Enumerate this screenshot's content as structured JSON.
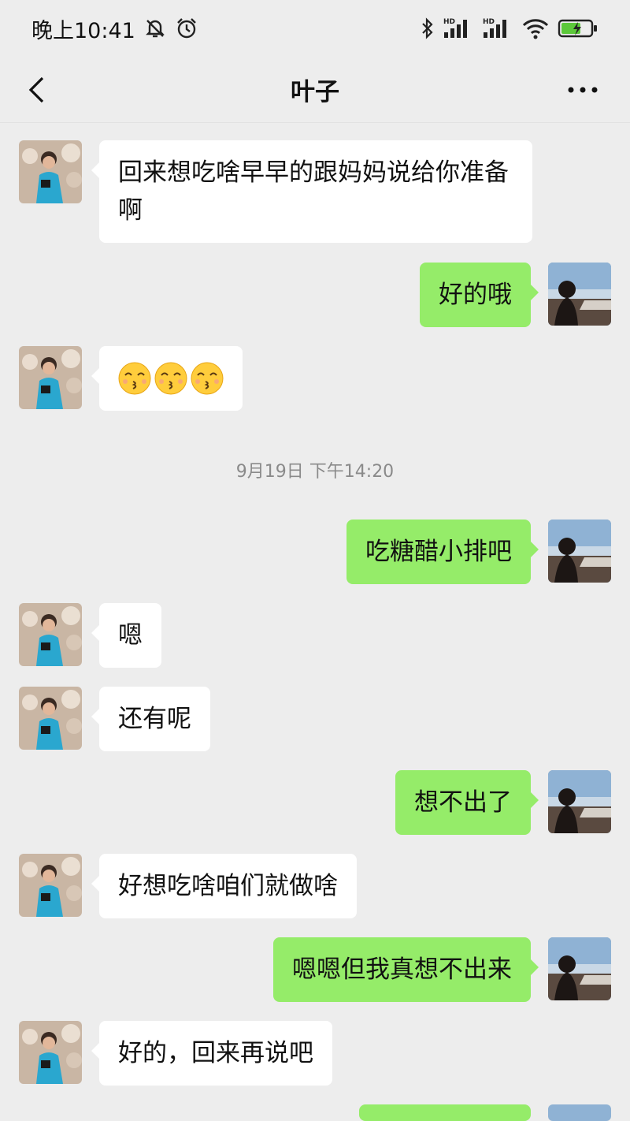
{
  "status_bar": {
    "time": "晚上10:41",
    "signal_1_label": "HD",
    "signal_2_label": "HD"
  },
  "header": {
    "title": "叶子"
  },
  "chat": {
    "messages": [
      {
        "side": "left",
        "text": "回来想吃啥早早的跟妈妈说给你准备啊"
      },
      {
        "side": "right",
        "text": "好的哦"
      },
      {
        "side": "left",
        "emoji": [
          "kissing-face-smiling-eyes",
          "kissing-face-smiling-eyes",
          "kissing-face-smiling-eyes"
        ]
      },
      {
        "side": "right",
        "text": "吃糖醋小排吧"
      },
      {
        "side": "left",
        "text": "嗯"
      },
      {
        "side": "left",
        "text": "还有呢"
      },
      {
        "side": "right",
        "text": "想不出了"
      },
      {
        "side": "left",
        "text": "好想吃啥咱们就做啥"
      },
      {
        "side": "right",
        "text": "嗯嗯但我真想不出来"
      },
      {
        "side": "left",
        "text": "好的，回来再说吧"
      }
    ],
    "timestamp": "9月19日 下午14:20"
  },
  "colors": {
    "background": "#ededed",
    "incoming_bubble": "#ffffff",
    "outgoing_bubble": "#95ec69",
    "timestamp_text": "#8a8a8a"
  }
}
